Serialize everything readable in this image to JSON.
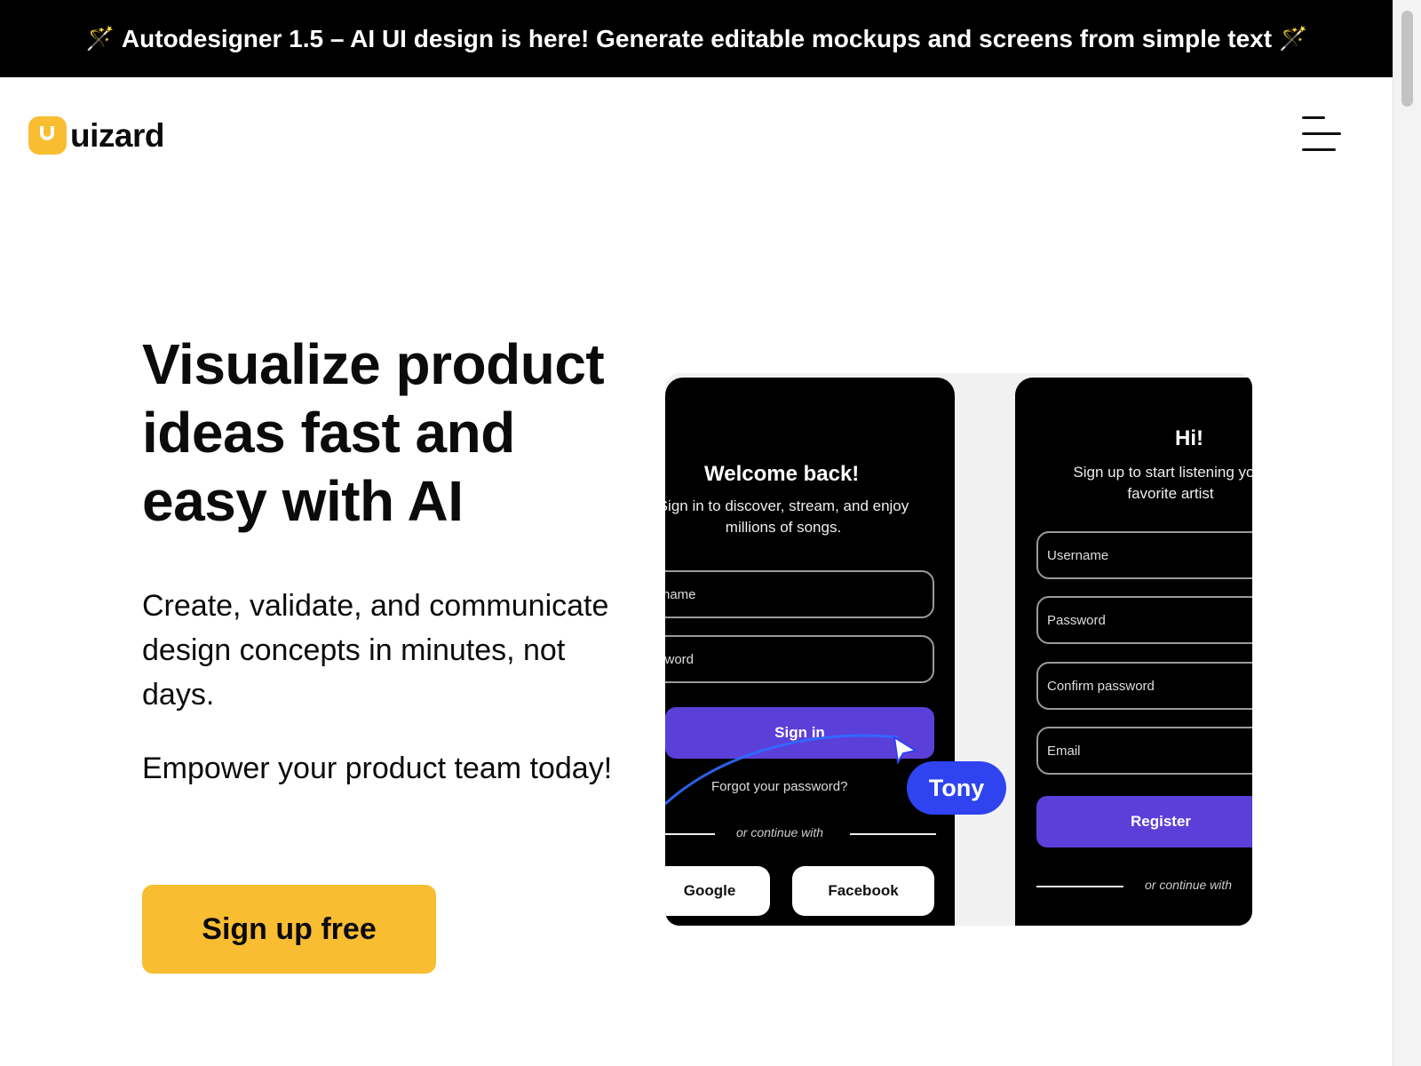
{
  "announcement": {
    "icon": "magic-wand-icon",
    "text": "Autodesigner 1.5 – AI UI design is here! Generate editable mockups and screens from simple text"
  },
  "header": {
    "logo_text": "uizard",
    "menu_icon": "hamburger-menu-icon"
  },
  "hero": {
    "headline": "Visualize product ideas fast and easy with AI",
    "lead": "Create, validate, and communicate design concepts in minutes, not days.",
    "lead2": "Empower your product team today!",
    "cta": "Sign up free"
  },
  "preview": {
    "signin": {
      "title": "Welcome back!",
      "subtitle": "Sign in to discover, stream, and enjoy millions of songs.",
      "username_visible": "rname",
      "password_visible": "sword",
      "button": "Sign in",
      "forgot": "Forgot your password?",
      "continue": "or continue with",
      "google": "Google",
      "facebook": "Facebook"
    },
    "signup": {
      "title": "Hi!",
      "subtitle": "Sign up to start listening your favorite artist",
      "username": "Username",
      "password": "Password",
      "confirm": "Confirm password",
      "email": "Email",
      "button": "Register",
      "continue": "or continue with"
    },
    "cursor_label": "Tony"
  },
  "colors": {
    "brand_yellow": "#f9bd32",
    "announcement_bg": "#000000",
    "mockup_purple": "#5b3fd9",
    "cursor_blue": "#2f44f0"
  }
}
